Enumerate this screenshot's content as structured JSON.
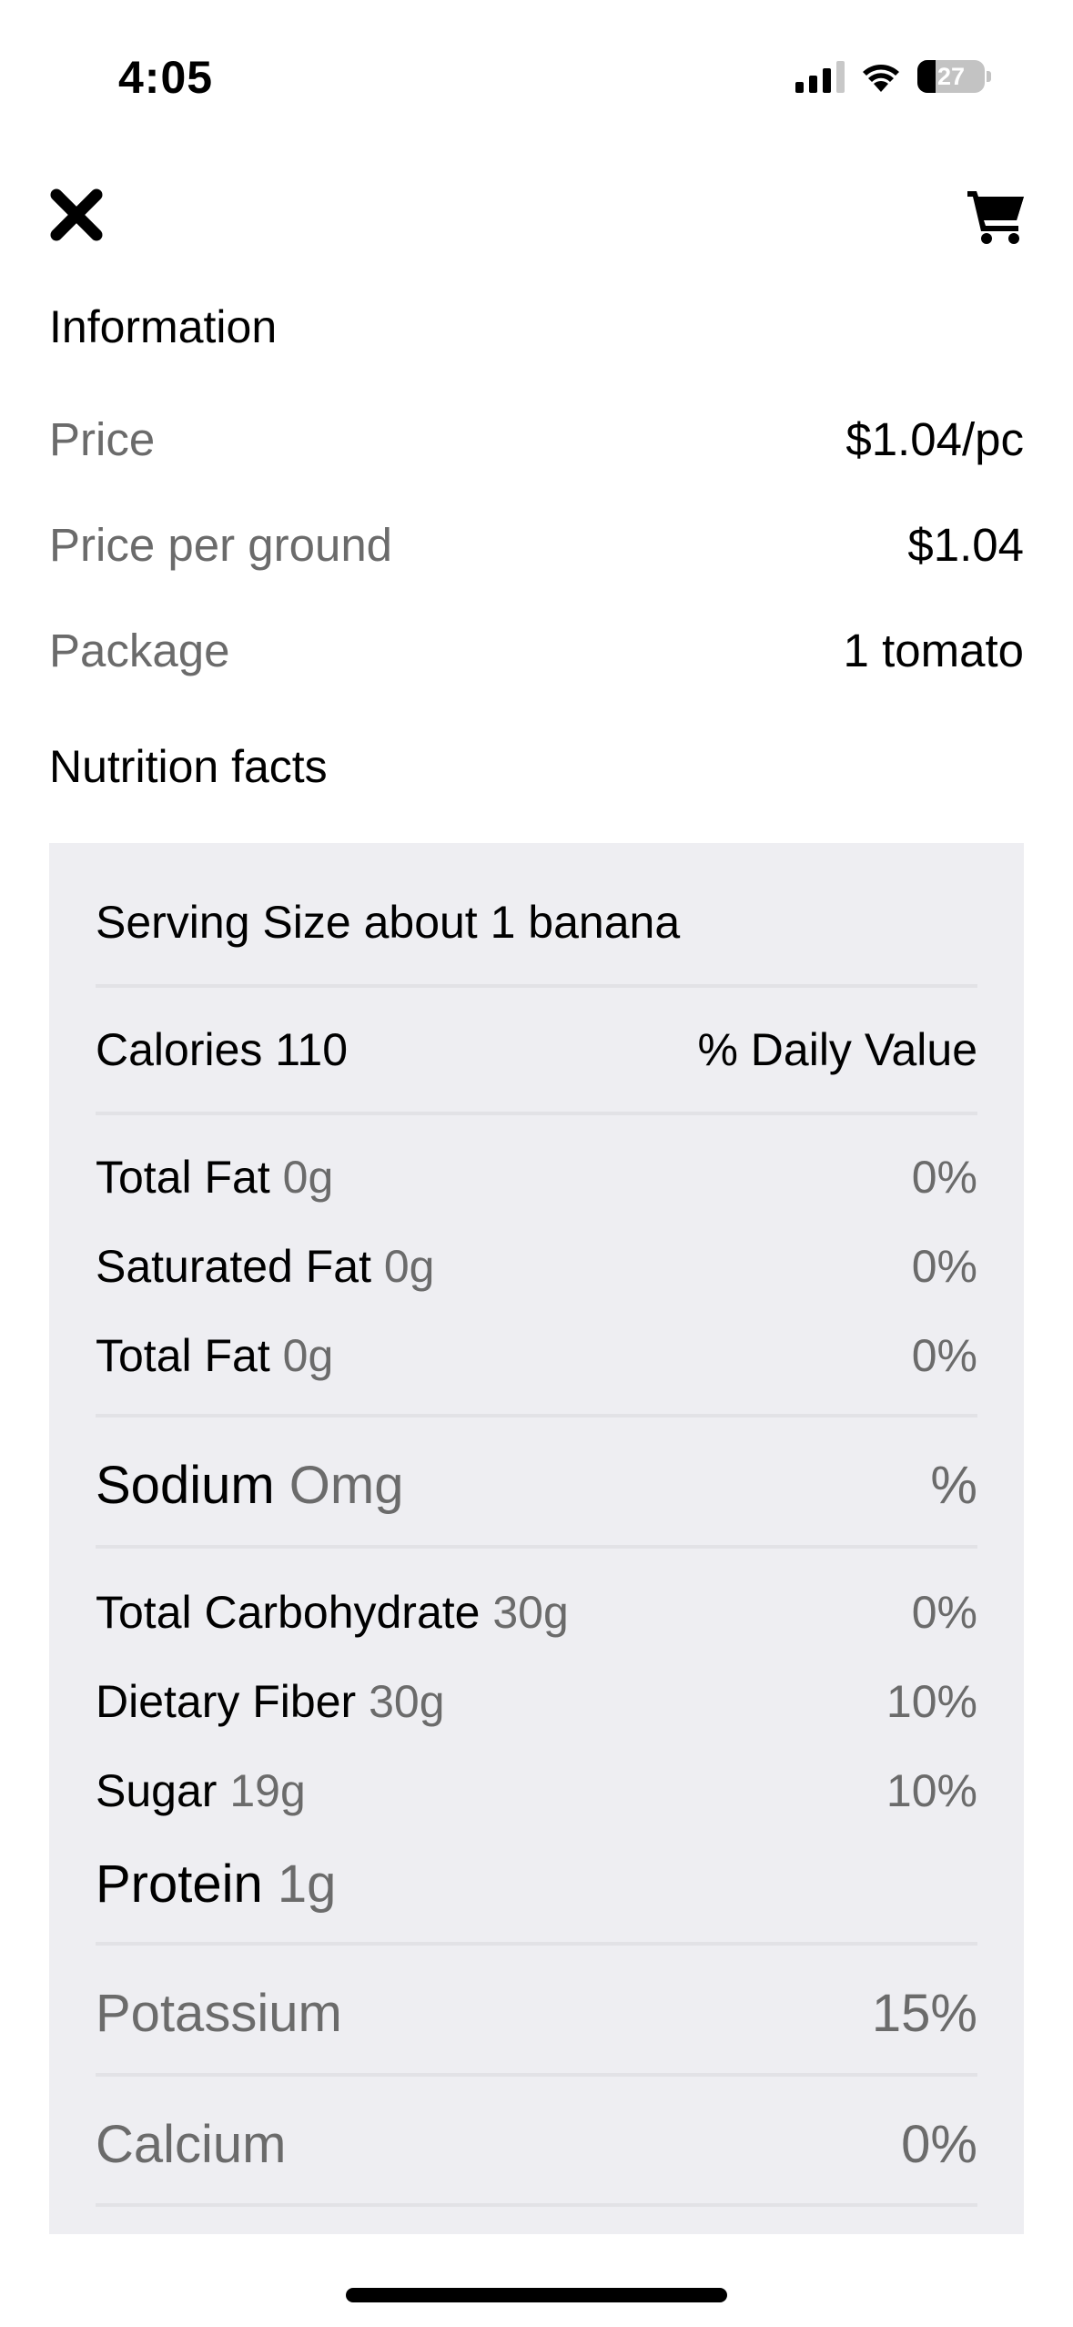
{
  "status_bar": {
    "time": "4:05",
    "battery_level": "27"
  },
  "nav": {
    "close_icon": "close-x-icon",
    "cart_icon": "cart-icon"
  },
  "information": {
    "title": "Information",
    "rows": [
      {
        "label": "Price",
        "value": "$1.04/pc"
      },
      {
        "label": "Price per ground",
        "value": "$1.04"
      },
      {
        "label": "Package",
        "value": "1 tomato"
      }
    ]
  },
  "nutrition": {
    "title": "Nutrition facts",
    "serving_size": "Serving Size about 1 banana",
    "calories": "Calories 110",
    "daily_value_header": "% Daily Value",
    "fats": [
      {
        "name": "Total Fat",
        "amount": "0g",
        "percent": "0%"
      },
      {
        "name": "Saturated Fat",
        "amount": "0g",
        "percent": "0%"
      },
      {
        "name": "Total Fat",
        "amount": "0g",
        "percent": "0%"
      }
    ],
    "sodium": {
      "name": "Sodium",
      "amount": "Omg",
      "percent": "%"
    },
    "carbs": [
      {
        "name": "Total Carbohydrate",
        "amount": "30g",
        "percent": "0%"
      },
      {
        "name": "Dietary Fiber",
        "amount": "30g",
        "percent": "10%"
      },
      {
        "name": "Sugar",
        "amount": "19g",
        "percent": "10%"
      }
    ],
    "protein": {
      "name": "Protein",
      "amount": "1g"
    },
    "minerals": [
      {
        "name": "Potassium",
        "percent": "15%"
      },
      {
        "name": "Calcium",
        "percent": "0%"
      }
    ]
  }
}
